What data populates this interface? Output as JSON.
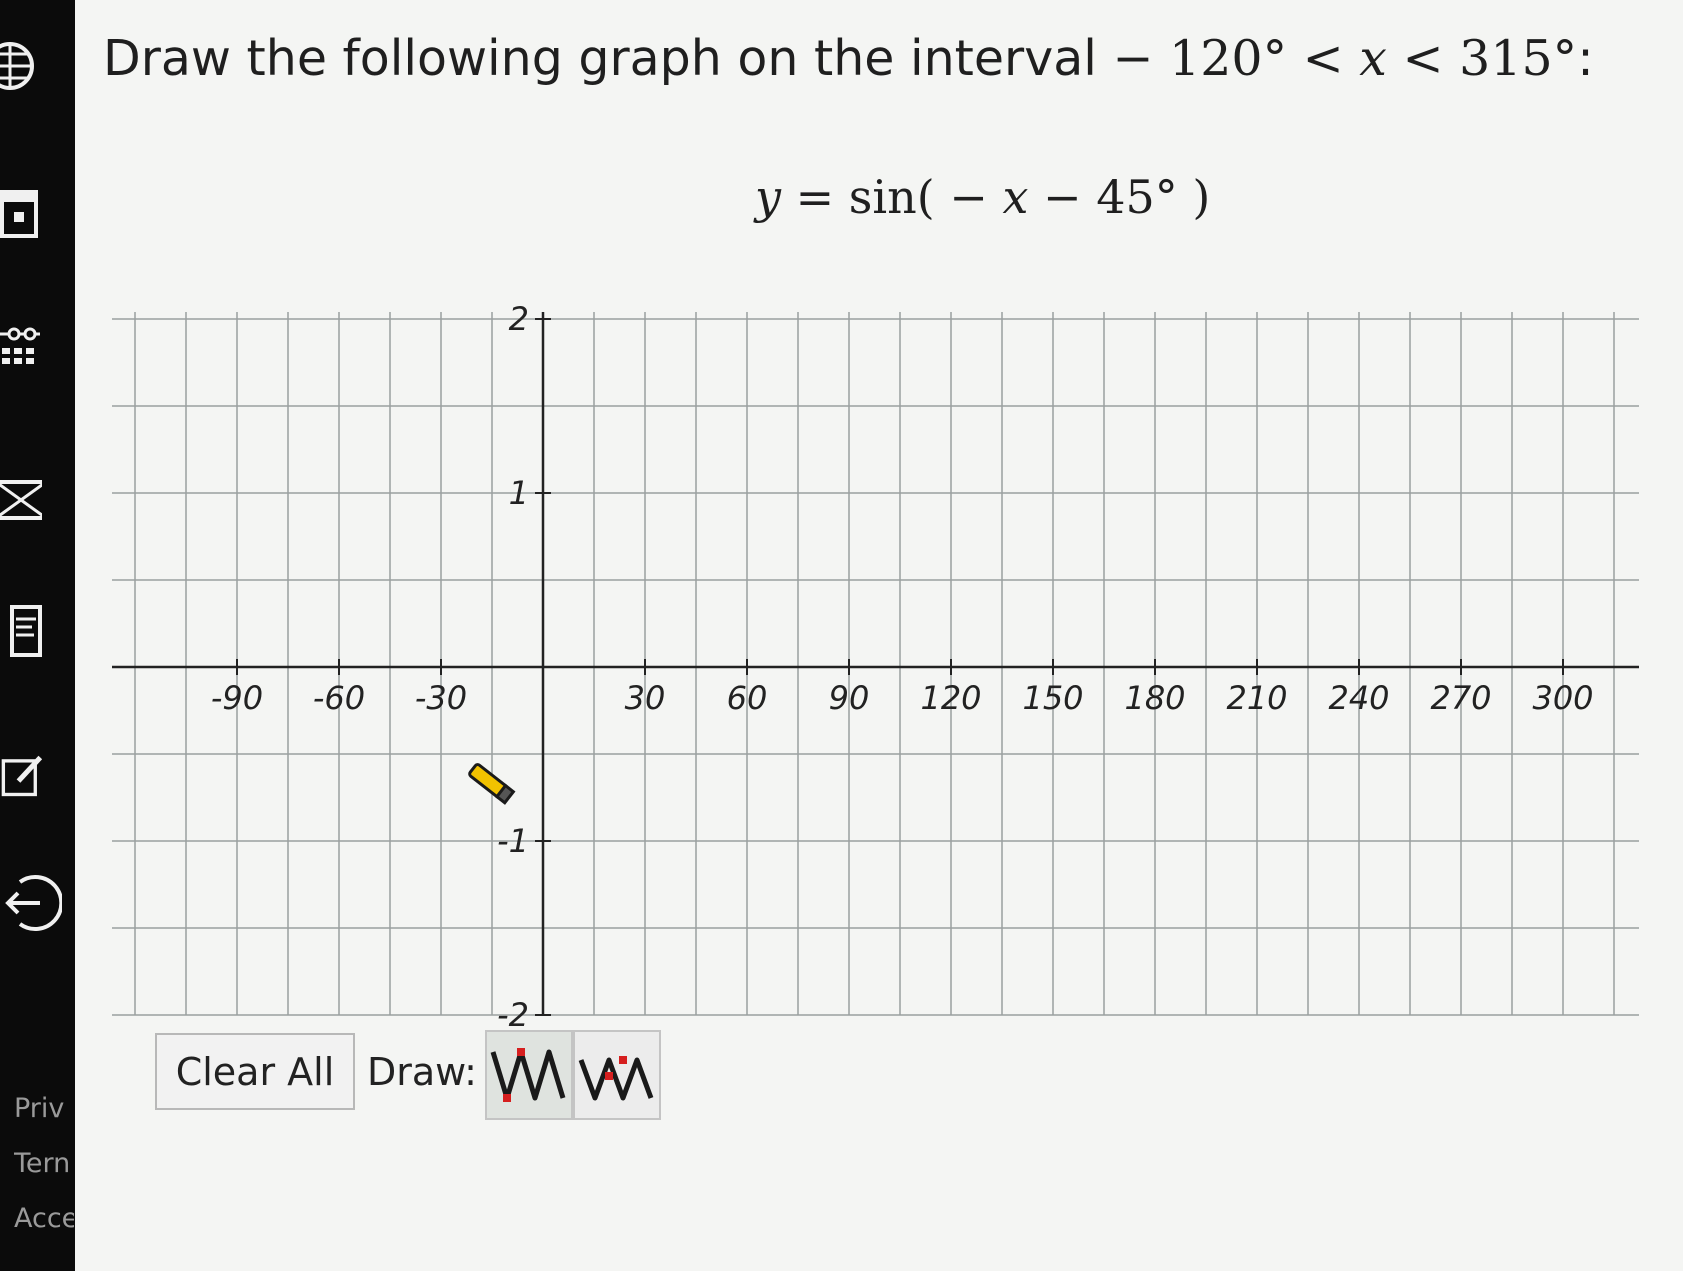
{
  "question": {
    "prefix": "Draw the following graph on the interval ",
    "lower": "− 120°",
    "lt": " < ",
    "var": "x",
    "upper": "315°",
    "suffix": ":"
  },
  "equation": {
    "lhs": "y",
    "rest": " = sin( − ",
    "var": "x",
    "tail": " − 45° )"
  },
  "graph": {
    "x_ticks": [
      "-90",
      "-60",
      "-30",
      "30",
      "60",
      "90",
      "120",
      "150",
      "180",
      "210",
      "240",
      "270",
      "300"
    ],
    "y_ticks": [
      "2",
      "1",
      "-1",
      "-2"
    ],
    "xlim": [
      -120,
      315
    ],
    "ylim": [
      -2,
      2
    ],
    "x_grid_step": 15,
    "y_grid_step": 0.5
  },
  "toolbar": {
    "clear_label": "Clear All",
    "draw_label": "Draw:",
    "tools": [
      "sine-tool-icon",
      "sine-tool-alt-icon"
    ]
  },
  "sidebar": {
    "links": [
      "Priv",
      "Tern",
      "Acce"
    ],
    "icons": [
      "globe-icon",
      "calculator-icon",
      "sliders-icon",
      "mail-icon",
      "notes-icon",
      "edit-icon",
      "logout-icon"
    ]
  },
  "colors": {
    "axis": "#222222",
    "grid": "#9aa0a0",
    "curve_accent": "#d61f1f",
    "curve": "#1a1a1a"
  }
}
